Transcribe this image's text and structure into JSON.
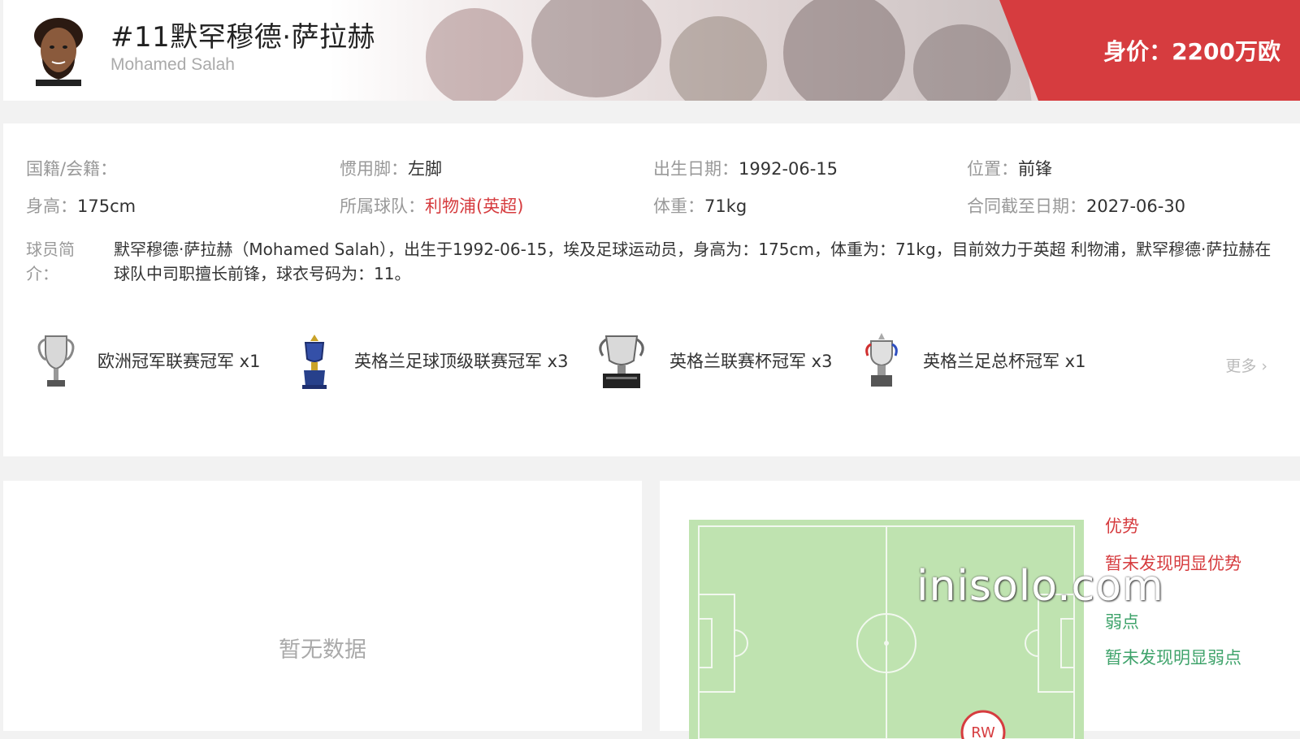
{
  "header": {
    "title": "#11默罕穆德·萨拉赫",
    "subtitle": "Mohamed Salah",
    "market_value": "身价：2200万欧",
    "accent_color": "#d63c3f"
  },
  "info": {
    "fields": [
      {
        "label": "国籍/会籍：",
        "value": ""
      },
      {
        "label": "惯用脚：",
        "value": "左脚"
      },
      {
        "label": "出生日期：",
        "value": "1992-06-15"
      },
      {
        "label": "位置：",
        "value": "前锋"
      },
      {
        "label": "身高：",
        "value": "175cm"
      },
      {
        "label": "所属球队：",
        "value": "利物浦(英超)"
      },
      {
        "label": "体重：",
        "value": "71kg"
      },
      {
        "label": "合同截至日期：",
        "value": "2027-06-30"
      }
    ],
    "bio_label": "球员简介：",
    "bio_text": "默罕穆德·萨拉赫（Mohamed Salah），出生于1992-06-15，埃及足球运动员，身高为：175cm，体重为：71kg，目前效力于英超 利物浦，默罕穆德·萨拉赫在球队中司职擅长前锋，球衣号码为：11。"
  },
  "trophies": [
    {
      "label": "欧洲冠军联赛冠军 x1",
      "icon": "champions-league-trophy-icon"
    },
    {
      "label": "英格兰足球顶级联赛冠军 x3",
      "icon": "premier-league-trophy-icon"
    },
    {
      "label": "英格兰联赛杯冠军 x3",
      "icon": "league-cup-trophy-icon"
    },
    {
      "label": "英格兰足总杯冠军 x1",
      "icon": "fa-cup-trophy-icon"
    }
  ],
  "more_label": "更多",
  "empty_state": "暂无数据",
  "pitch": {
    "position_marker": "RW",
    "strengths_title": "优势",
    "strengths_text": "暂未发现明显优势",
    "weaknesses_title": "弱点",
    "weaknesses_text": "暂未发现明显弱点",
    "strength_color": "#d63c3f",
    "weakness_color": "#3fa36b",
    "pitch_color": "#bfe3b0"
  },
  "watermark": "inisolo.com"
}
